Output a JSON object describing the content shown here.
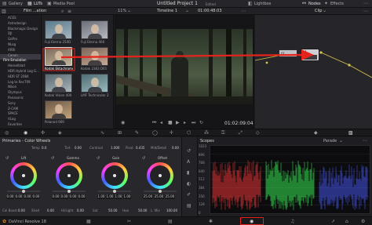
{
  "topbar": {
    "tabs": [
      {
        "icon": "gallery-icon",
        "label": "Gallery"
      },
      {
        "icon": "luts-icon",
        "label": "LUTs"
      },
      {
        "icon": "media-pool-icon",
        "label": "Media Pool"
      }
    ],
    "project_title": "Untitled Project 1",
    "project_status": "Edited",
    "right_tabs": [
      {
        "icon": "lightbox-icon",
        "label": "Lightbox"
      },
      {
        "icon": "nodes-icon",
        "label": "Nodes"
      },
      {
        "icon": "effects-icon",
        "label": "Effects"
      }
    ]
  },
  "toolbar2": {
    "lut_folder": "Film ...ation",
    "zoom": "11%",
    "timeline": "Timeline 1",
    "timecode": "01:00:48:03",
    "clip_label": "Clip"
  },
  "lut_tree": {
    "items": [
      "ACES",
      "Astrodesign",
      "Blackmagic Design",
      "DJI",
      "GoPro",
      "NLog",
      "ARRI",
      "Canon",
      "Film Emulation",
      "Hasselblad",
      "HDR Hybrid Log G...",
      "HDR ST 2084",
      "Log to Rec709",
      "Nikon",
      "Olympus",
      "Panasonic",
      "Sony",
      "Z-CAM",
      "SPACE",
      "VLog",
      "Favorites"
    ],
    "selected_index": 8
  },
  "lut_grid": {
    "items": [
      "Fuji Eterna 250D",
      "Fuji Eterna 400",
      "Kodak Ektachrome 64",
      "Kodak 2383 D65",
      "Kodak Vision 400",
      "LMF Technicolor 2383",
      "Polaroid 669"
    ],
    "selected_index": 2
  },
  "viewer": {
    "timecode": "01:02:09:04"
  },
  "nodes": {
    "node_label": "01",
    "ghost_label": "01"
  },
  "wheels": {
    "title": "Primaries - Color Wheels",
    "top_params": [
      {
        "label": "Temp",
        "value": "0.0"
      },
      {
        "label": "Tint",
        "value": "0.00"
      },
      {
        "label": "Contrast",
        "value": "1.000"
      },
      {
        "label": "Pivot",
        "value": "0.435"
      },
      {
        "label": "Mid/Detail",
        "value": "0.00"
      }
    ],
    "items": [
      {
        "name": "Lift",
        "values": [
          "0.00",
          "0.00",
          "0.00",
          "0.00"
        ]
      },
      {
        "name": "Gamma",
        "values": [
          "0.00",
          "0.00",
          "0.00",
          "0.00"
        ]
      },
      {
        "name": "Gain",
        "values": [
          "1.00",
          "1.00",
          "1.00",
          "1.00"
        ]
      },
      {
        "name": "Offset",
        "values": [
          "25.00",
          "25.00",
          "25.00"
        ]
      }
    ],
    "bottom_params": [
      {
        "label": "Col Boost",
        "value": "0.00"
      },
      {
        "label": "Shad",
        "value": "0.00"
      },
      {
        "label": "Hi/Light",
        "value": "0.00"
      },
      {
        "label": "Sat",
        "value": "50.00"
      },
      {
        "label": "Hue",
        "value": "50.00"
      },
      {
        "label": "L. Mix",
        "value": "100.00"
      }
    ]
  },
  "scopes": {
    "title": "Scopes",
    "mode": "Parade",
    "ticks": [
      "1023",
      "896",
      "768",
      "640",
      "512",
      "384",
      "256",
      "128",
      "0"
    ]
  },
  "bottombar": {
    "app_name": "DaVinci Resolve 18",
    "pages": [
      "media-page-icon",
      "cut-page-icon",
      "edit-page-icon",
      "fusion-page-icon",
      "color-page-icon",
      "fairlight-page-icon",
      "deliver-page-icon"
    ],
    "active_page_index": 4
  },
  "colors": {
    "accent_red": "#e3231c",
    "panel": "#28282c",
    "scope_red": "#ff3b3b",
    "scope_green": "#3bff5a",
    "scope_blue": "#4a5bff"
  }
}
